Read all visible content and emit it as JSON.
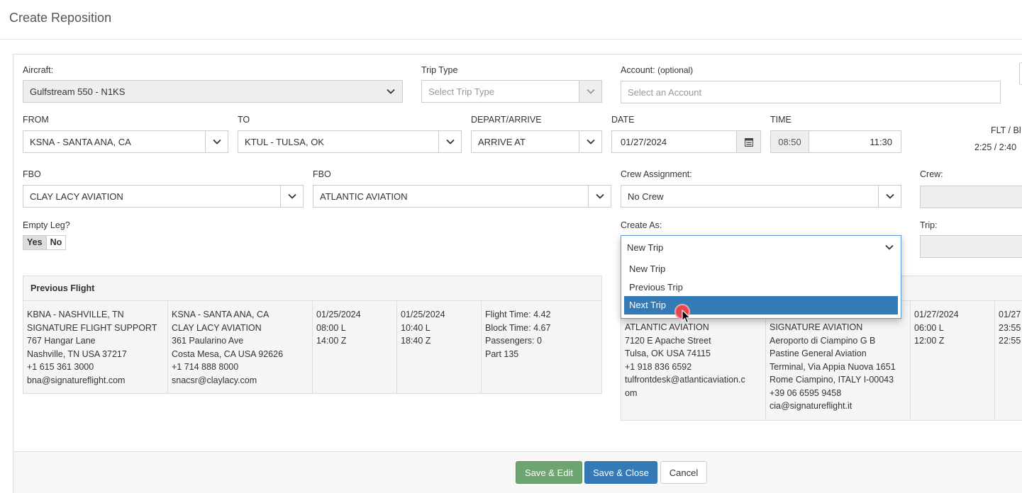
{
  "page": {
    "title": "Create Reposition"
  },
  "aircraft": {
    "label": "Aircraft:",
    "value": "Gulfstream 550 - N1KS"
  },
  "trip_type": {
    "label": "Trip Type",
    "placeholder": "Select Trip Type"
  },
  "account": {
    "label": "Account:",
    "optional": "(optional)",
    "placeholder": "Select an Account"
  },
  "from": {
    "label": "FROM",
    "value": "KSNA - SANTA ANA, CA"
  },
  "to": {
    "label": "TO",
    "value": "KTUL - TULSA, OK"
  },
  "depart_arrive": {
    "label": "DEPART/ARRIVE",
    "value": "ARRIVE AT"
  },
  "date": {
    "label": "DATE",
    "value": "01/27/2024"
  },
  "time": {
    "label": "TIME",
    "start": "08:50",
    "end": "11:30"
  },
  "flt_block": {
    "label": "FLT / Bl",
    "value": "2:25 / 2:40"
  },
  "fbo_from": {
    "label": "FBO",
    "value": "CLAY LACY AVIATION"
  },
  "fbo_to": {
    "label": "FBO",
    "value": "ATLANTIC AVIATION"
  },
  "crew_assignment": {
    "label": "Crew Assignment:",
    "value": "No Crew"
  },
  "crew": {
    "label": "Crew:"
  },
  "empty_leg": {
    "label": "Empty Leg?",
    "yes": "Yes",
    "no": "No",
    "selected": "Yes"
  },
  "create_as": {
    "label": "Create As:",
    "value": "New Trip",
    "options": [
      "New Trip",
      "Previous Trip",
      "Next Trip"
    ],
    "highlighted": "Next Trip"
  },
  "trip": {
    "label": "Trip:"
  },
  "previous_flight": {
    "header": "Previous Flight",
    "cells": [
      "KBNA - NASHVILLE, TN\nSIGNATURE FLIGHT SUPPORT\n767 Hangar Lane\nNashville, TN USA 37217\n+1 615 361 3000\nbna@signatureflight.com",
      "KSNA - SANTA ANA, CA\nCLAY LACY AVIATION\n361 Paularino Ave\nCosta Mesa, CA USA 92626\n+1 714 888 8000\nsnacsr@claylacy.com",
      "01/25/2024\n08:00 L\n14:00 Z",
      "01/25/2024\n10:40 L\n18:40 Z",
      "Flight Time: 4.42\nBlock Time: 4.67\nPassengers: 0\nPart 135"
    ]
  },
  "next_flight": {
    "cells": [
      "ATLANTIC AVIATION\n7120 E Apache Street\nTulsa, OK USA 74115\n+1 918 836 6592\ntulfrontdesk@atlanticaviation.c\nom",
      "SIGNATURE AVIATION\nAeroporto di Ciampino G B\nPastine General Aviation\nTerminal, Via Appia Nuova 1651\nRome Ciampino, ITALY I-00043\n+39 06 6595 9458\ncia@signatureflight.it",
      "01/27/2024\n06:00 L\n12:00 Z",
      "01/27\n23:55\n22:55"
    ]
  },
  "footer": {
    "save_edit": "Save & Edit",
    "save_close": "Save & Close",
    "cancel": "Cancel"
  },
  "colors": {
    "primary": "#337ab7",
    "success": "#6ea470",
    "cursor_dot": "#e8484d"
  }
}
